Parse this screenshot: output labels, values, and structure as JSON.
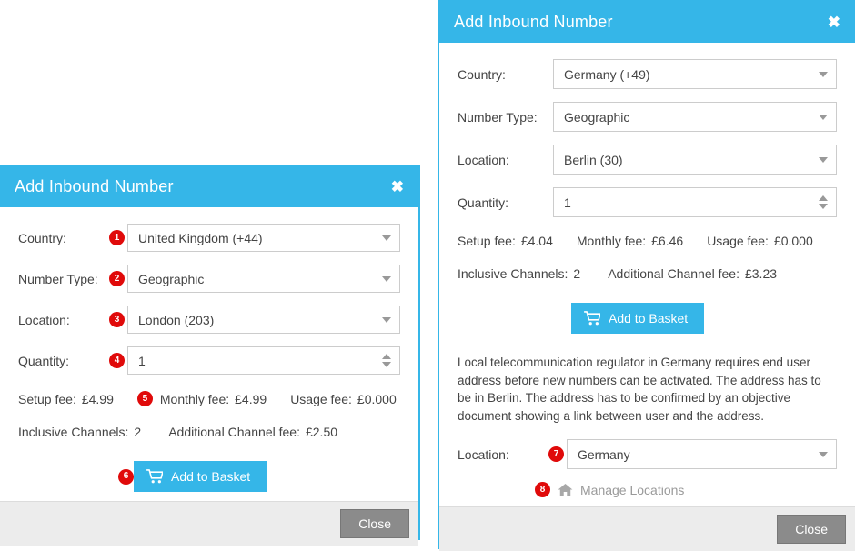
{
  "left_dialog": {
    "title": "Add Inbound Number",
    "close_icon": "close-x-icon",
    "fields": [
      {
        "badge": "1",
        "label": "Country:",
        "value": "United Kingdom (+44)"
      },
      {
        "badge": "2",
        "label": "Number Type:",
        "value": "Geographic"
      },
      {
        "badge": "3",
        "label": "Location:",
        "value": "London (203)"
      },
      {
        "badge": "4",
        "label": "Quantity:",
        "value": "1"
      }
    ],
    "fees": {
      "setup_label": "Setup fee:",
      "setup_value": "£4.99",
      "badge": "5",
      "monthly_label": "Monthly fee:",
      "monthly_value": "£4.99",
      "usage_label": "Usage fee:",
      "usage_value": "£0.000"
    },
    "channels": {
      "inclusive_label": "Inclusive Channels:",
      "inclusive_value": "2",
      "additional_label": "Additional Channel fee:",
      "additional_value": "£2.50"
    },
    "basket": {
      "badge": "6",
      "label": "Add to Basket",
      "icon": "shopping-cart-icon"
    },
    "footer": {
      "close_label": "Close"
    }
  },
  "right_dialog": {
    "title": "Add Inbound Number",
    "close_icon": "close-x-icon",
    "fields": [
      {
        "label": "Country:",
        "value": "Germany (+49)"
      },
      {
        "label": "Number Type:",
        "value": "Geographic"
      },
      {
        "label": "Location:",
        "value": "Berlin (30)"
      },
      {
        "label": "Quantity:",
        "value": "1"
      }
    ],
    "fees": {
      "setup_label": "Setup fee:",
      "setup_value": "£4.04",
      "monthly_label": "Monthly fee:",
      "monthly_value": "£6.46",
      "usage_label": "Usage fee:",
      "usage_value": "£0.000"
    },
    "channels": {
      "inclusive_label": "Inclusive Channels:",
      "inclusive_value": "2",
      "additional_label": "Additional Channel fee:",
      "additional_value": "£3.23"
    },
    "basket": {
      "label": "Add to Basket",
      "icon": "shopping-cart-icon"
    },
    "notice": "Local telecommunication regulator in Germany requires end user address before new numbers can be activated. The address has to be in Berlin. The address has to be confirmed by an objective document showing a link between user and the address.",
    "location_field": {
      "badge": "7",
      "label": "Location:",
      "value": "Germany"
    },
    "manage": {
      "badge": "8",
      "label": "Manage Locations",
      "icon": "home-icon"
    },
    "footer": {
      "close_label": "Close"
    }
  },
  "colors": {
    "accent_blue": "#35b6e8",
    "badge_red": "#e00a0a",
    "close_gray": "#8b8b8b",
    "footer_gray": "#ececec",
    "text_gray": "#444444",
    "muted_gray": "#9a9a9a"
  }
}
